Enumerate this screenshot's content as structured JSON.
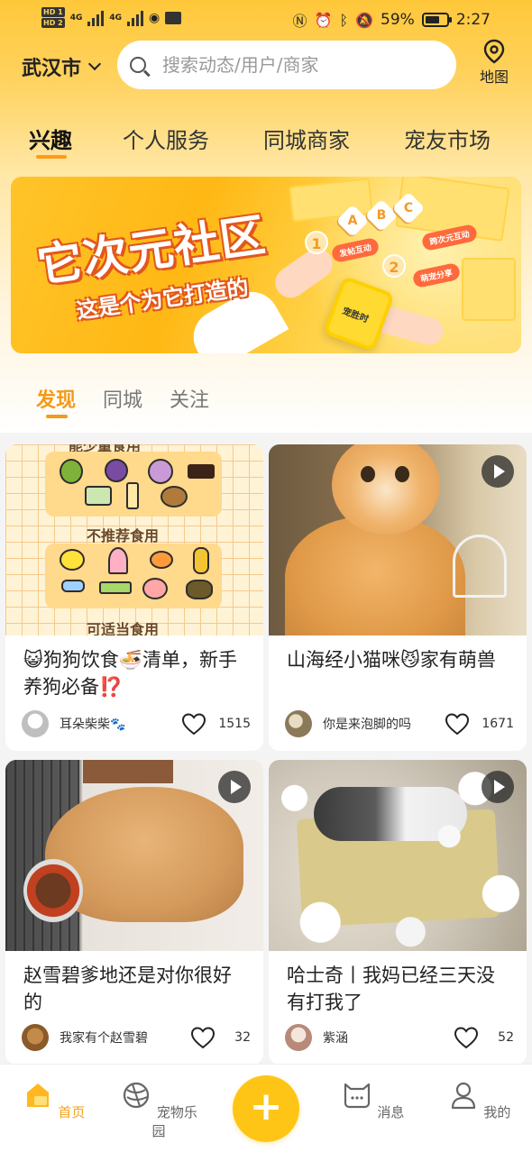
{
  "status_bar": {
    "hd1": "HD 1",
    "hd2": "HD 2",
    "net1": "4G",
    "net2": "4G",
    "battery": "59%",
    "time": "2:27"
  },
  "header": {
    "city": "武汉市",
    "search_placeholder": "搜索动态/用户/商家",
    "map_label": "地图"
  },
  "main_tabs": [
    {
      "label": "兴趣",
      "active": true
    },
    {
      "label": "个人服务",
      "active": false
    },
    {
      "label": "同城商家",
      "active": false
    },
    {
      "label": "宠友市场",
      "active": false
    }
  ],
  "banner": {
    "title": "它次元社区",
    "subtitle": "这是个为它打造的",
    "hex_labels": [
      "A",
      "B",
      "C"
    ],
    "steps": [
      {
        "num": "1",
        "text": "发帖互动"
      },
      {
        "num": "2",
        "text": "跨次元互动"
      },
      {
        "num": "",
        "text": "萌宠分享"
      }
    ],
    "phone_text": "宠胜时"
  },
  "feed_tabs": [
    {
      "label": "发现",
      "active": true
    },
    {
      "label": "同城",
      "active": false
    },
    {
      "label": "关注",
      "active": false
    }
  ],
  "feed": [
    {
      "title": "😺狗狗饮食🍜清单，新手养狗必备⁉️",
      "user": "耳朵柴柴🐾",
      "likes": "1515",
      "is_video": false,
      "image_text": {
        "top": "能少量食用",
        "mid": "不推荐食用",
        "bottom": "可适当食用"
      }
    },
    {
      "title": "山海经小猫咪😼家有萌兽",
      "user": "你是来泡脚的吗",
      "likes": "1671",
      "is_video": true
    },
    {
      "title": "赵雪碧爹地还是对你很好的",
      "user": "我家有个赵雪碧",
      "likes": "32",
      "is_video": true
    },
    {
      "title": "哈士奇丨我妈已经三天没有打我了",
      "user": "紫涵",
      "likes": "52",
      "is_video": true
    }
  ],
  "bottom_nav": [
    {
      "label": "首页",
      "icon": "home-icon",
      "active": true
    },
    {
      "label": "宠物乐园",
      "icon": "planet-icon",
      "active": false
    },
    {
      "label": "+",
      "icon": "plus-icon",
      "active": false
    },
    {
      "label": "消息",
      "icon": "message-icon",
      "active": false
    },
    {
      "label": "我的",
      "icon": "profile-icon",
      "active": false
    }
  ],
  "colors": {
    "brand_yellow": "#ffc516",
    "accent_orange": "#f39a1a",
    "tab_underline": "#ff9a1a"
  }
}
